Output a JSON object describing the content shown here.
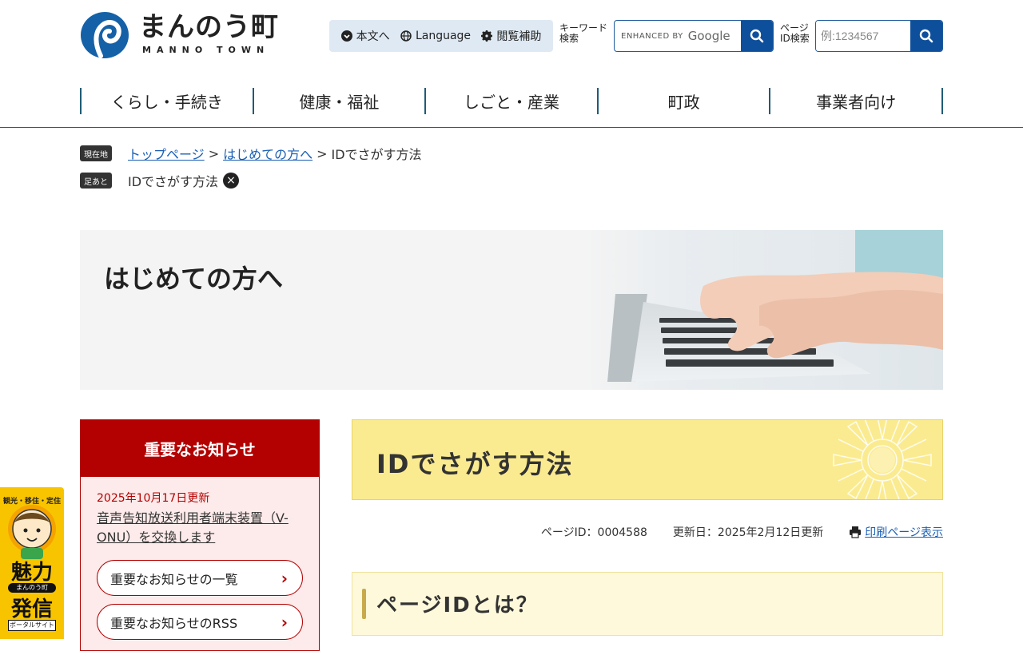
{
  "header": {
    "logo_jp": "まんのう町",
    "logo_en": "MANNO TOWN",
    "skip_label": "本文へ",
    "language_label": "Language",
    "accessibility_label": "閲覧補助",
    "keyword_label_1": "キーワード",
    "keyword_label_2": "検索",
    "keyword_enhanced": "ENHANCED BY",
    "keyword_google": "Google",
    "id_label_1": "ページ",
    "id_label_2": "ID検索",
    "id_placeholder": "例:1234567"
  },
  "gnav": [
    "くらし・手続き",
    "健康・福祉",
    "しごと・産業",
    "町政",
    "事業者向け"
  ],
  "breadcrumb": {
    "current_tag": "現在地",
    "home": "トップページ",
    "parent": "はじめての方へ",
    "current": "IDでさがす方法",
    "history_tag": "足あと",
    "history_item": "IDでさがす方法",
    "separator": ">"
  },
  "hero": {
    "title": "はじめての方へ"
  },
  "notice": {
    "heading": "重要なお知らせ",
    "date": "2025年10月17日更新",
    "link": "音声告知放送利用者端末装置（V-ONU）を交換します",
    "list_label": "重要なお知らせの一覧",
    "rss_label": "重要なお知らせのRSS"
  },
  "page": {
    "title": "IDでさがす方法",
    "page_id": "ページID：0004588",
    "updated": "更新日：2025年2月12日更新",
    "print_label": "印刷ページ表示",
    "section_heading": "ページIDとは？"
  },
  "banner": {
    "top": "観光・移住・定住",
    "big1": "魅力",
    "pill": "まんのう町",
    "big2": "発信",
    "bottom": "ポータルサイト"
  },
  "colors": {
    "brand_blue": "#0e4f9c",
    "notice_red": "#b30000",
    "title_yellow": "#fbeb90",
    "banner_yellow": "#f8c400"
  }
}
